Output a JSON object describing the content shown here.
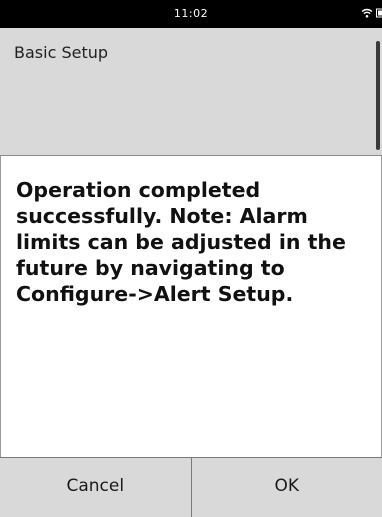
{
  "status_bar": {
    "time": "11:02",
    "icons": [
      "wifi-icon",
      "battery-icon"
    ]
  },
  "header": {
    "title": "Basic Setup"
  },
  "dialog": {
    "message": "Operation completed successfully. Note: Alarm limits can be adjusted in the future by navigating to Configure->Alert Setup."
  },
  "footer": {
    "cancel_label": "Cancel",
    "ok_label": "OK"
  },
  "colors": {
    "status_bar_bg": "#000000",
    "header_bg": "#d9d9d9",
    "content_bg": "#ffffff",
    "footer_bg": "#d9d9d9"
  }
}
